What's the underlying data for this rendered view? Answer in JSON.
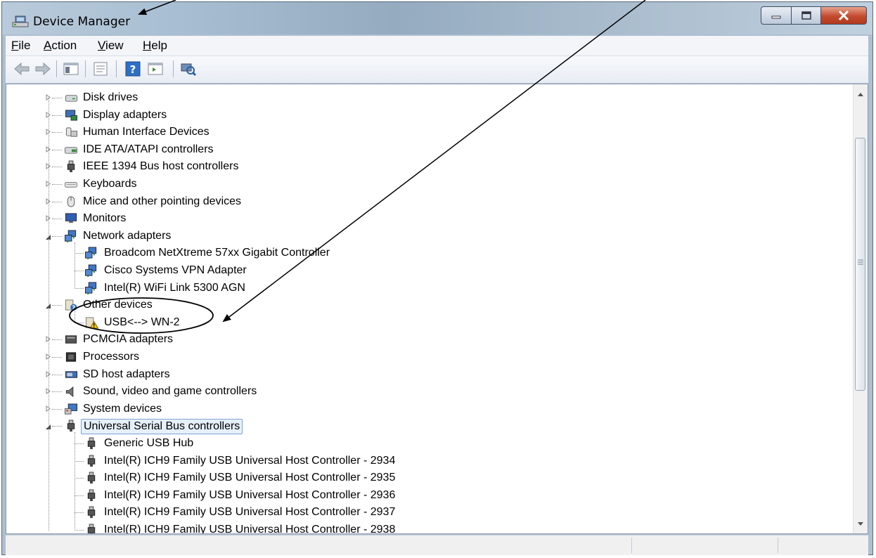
{
  "window": {
    "title": "Device Manager",
    "icon": "device-manager-icon"
  },
  "caption_buttons": [
    "minimize",
    "maximize",
    "close"
  ],
  "menu": [
    {
      "label": "File",
      "access": "F",
      "rest": "ile"
    },
    {
      "label": "Action",
      "access": "A",
      "rest": "ction"
    },
    {
      "label": "View",
      "access": "V",
      "rest": "iew"
    },
    {
      "label": "Help",
      "access": "H",
      "rest": "elp"
    }
  ],
  "toolbar": [
    "back-arrow-icon",
    "forward-arrow-icon",
    "show-hide-console-tree-icon",
    "properties-icon",
    "help-icon",
    "action-pane-icon",
    "scan-for-hardware-changes-icon"
  ],
  "tree": {
    "items": [
      {
        "label": "Disk drives",
        "icon": "disk-drive-icon",
        "level": 0,
        "state": "collapsed"
      },
      {
        "label": "Display adapters",
        "icon": "display-adapter-icon",
        "level": 0,
        "state": "collapsed"
      },
      {
        "label": "Human Interface Devices",
        "icon": "hid-icon",
        "level": 0,
        "state": "collapsed"
      },
      {
        "label": "IDE ATA/ATAPI controllers",
        "icon": "ide-controller-icon",
        "level": 0,
        "state": "collapsed"
      },
      {
        "label": "IEEE 1394 Bus host controllers",
        "icon": "usb-plug-icon",
        "level": 0,
        "state": "collapsed"
      },
      {
        "label": "Keyboards",
        "icon": "keyboard-icon",
        "level": 0,
        "state": "collapsed"
      },
      {
        "label": "Mice and other pointing devices",
        "icon": "mouse-icon",
        "level": 0,
        "state": "collapsed"
      },
      {
        "label": "Monitors",
        "icon": "monitor-icon",
        "level": 0,
        "state": "collapsed"
      },
      {
        "label": "Network adapters",
        "icon": "network-adapter-icon",
        "level": 0,
        "state": "expanded"
      },
      {
        "label": "Broadcom NetXtreme 57xx Gigabit Controller",
        "icon": "network-adapter-icon",
        "level": 1
      },
      {
        "label": "Cisco Systems VPN Adapter",
        "icon": "network-adapter-icon",
        "level": 1
      },
      {
        "label": "Intel(R)  WiFi Link 5300 AGN",
        "icon": "network-adapter-icon",
        "level": 1
      },
      {
        "label": "Other devices",
        "icon": "unknown-device-icon",
        "level": 0,
        "state": "expanded"
      },
      {
        "label": "USB<--> WN-2",
        "icon": "warning-device-icon",
        "level": 1
      },
      {
        "label": "PCMCIA adapters",
        "icon": "pcmcia-icon",
        "level": 0,
        "state": "collapsed"
      },
      {
        "label": "Processors",
        "icon": "processor-icon",
        "level": 0,
        "state": "collapsed"
      },
      {
        "label": "SD host adapters",
        "icon": "sd-host-icon",
        "level": 0,
        "state": "collapsed"
      },
      {
        "label": "Sound, video and game controllers",
        "icon": "speaker-icon",
        "level": 0,
        "state": "collapsed"
      },
      {
        "label": "System devices",
        "icon": "system-devices-icon",
        "level": 0,
        "state": "collapsed"
      },
      {
        "label": "Universal Serial Bus controllers",
        "icon": "usb-plug-icon",
        "level": 0,
        "state": "expanded",
        "selected": true
      },
      {
        "label": "Generic USB Hub",
        "icon": "usb-plug-icon",
        "level": 1
      },
      {
        "label": "Intel(R) ICH9 Family USB Universal Host Controller - 2934",
        "icon": "usb-plug-icon",
        "level": 1
      },
      {
        "label": "Intel(R) ICH9 Family USB Universal Host Controller - 2935",
        "icon": "usb-plug-icon",
        "level": 1
      },
      {
        "label": "Intel(R) ICH9 Family USB Universal Host Controller - 2936",
        "icon": "usb-plug-icon",
        "level": 1
      },
      {
        "label": "Intel(R) ICH9 Family USB Universal Host Controller - 2937",
        "icon": "usb-plug-icon",
        "level": 1
      },
      {
        "label": "Intel(R) ICH9 Family USB Universal Host Controller - 2938",
        "icon": "usb-plug-icon",
        "level": 1
      }
    ]
  },
  "statusbar": {
    "text": ""
  },
  "annotations": {
    "arrows": 2,
    "ellipse_around": "USB<--> WN-2"
  }
}
